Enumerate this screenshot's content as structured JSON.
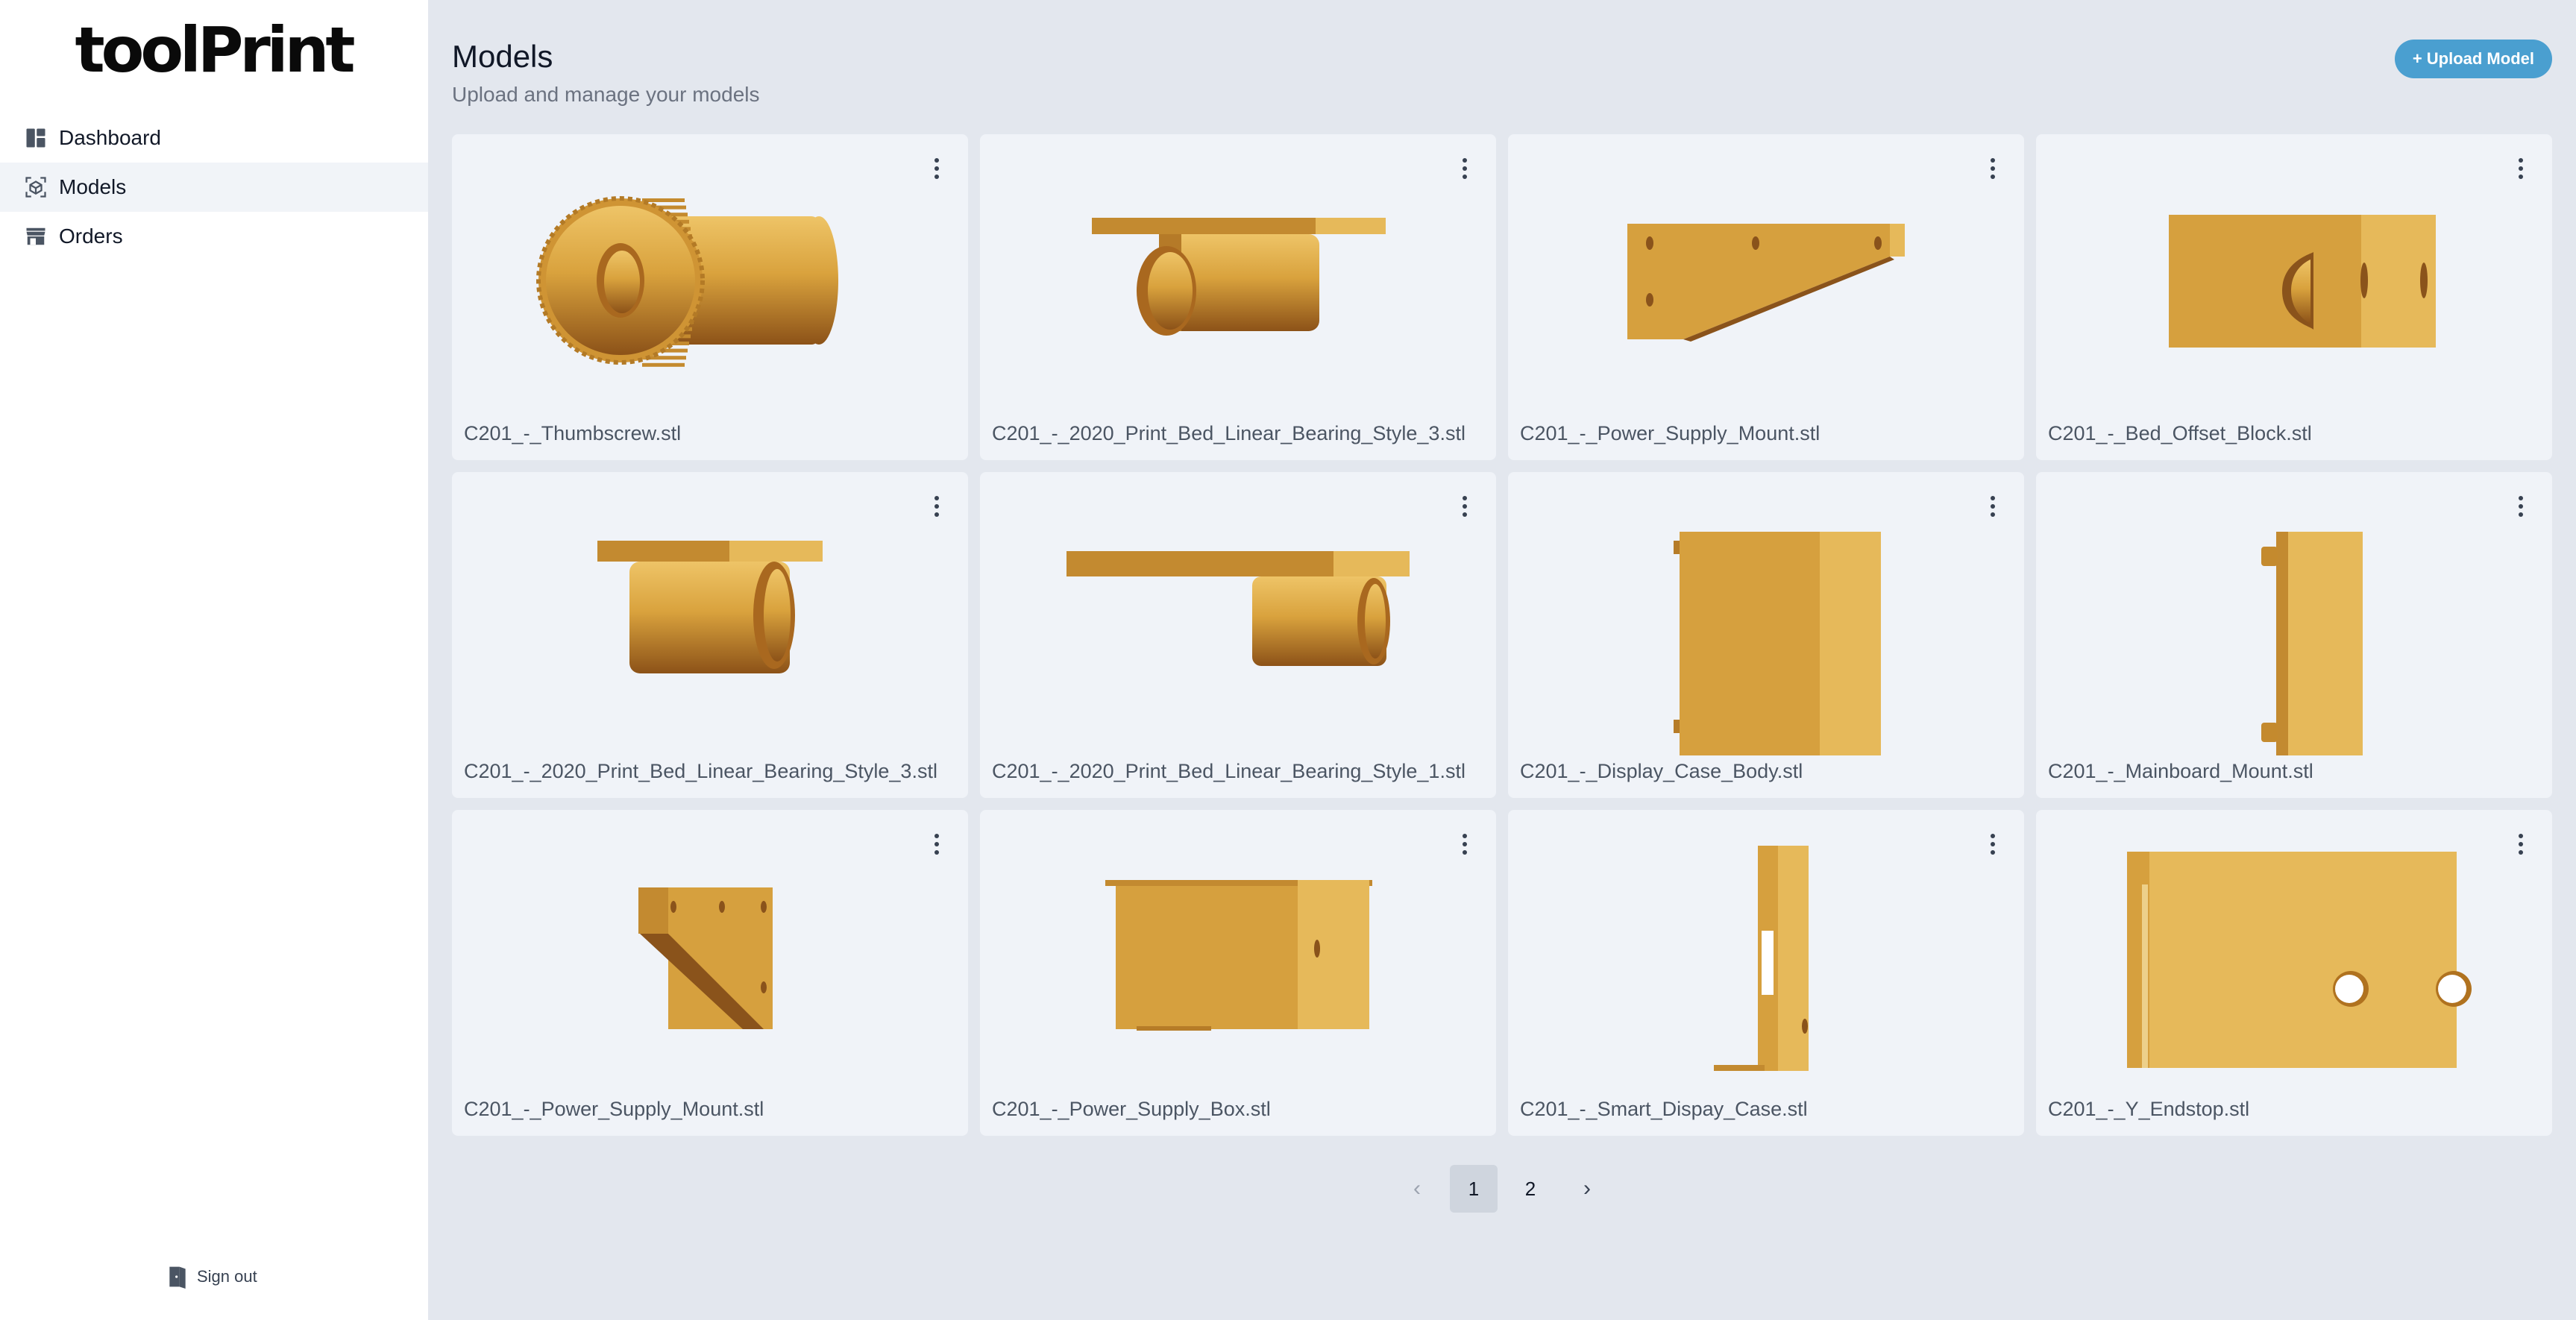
{
  "brand": {
    "logo_text": "toolPrint"
  },
  "sidebar": {
    "items": [
      {
        "label": "Dashboard",
        "icon": "dashboard-icon",
        "active": false
      },
      {
        "label": "Models",
        "icon": "cube-icon",
        "active": true
      },
      {
        "label": "Orders",
        "icon": "store-icon",
        "active": false
      }
    ],
    "signout_label": "Sign out"
  },
  "header": {
    "title": "Models",
    "subtitle": "Upload and manage your models",
    "upload_label": "+ Upload Model"
  },
  "colors": {
    "accent": "#4a9fd0",
    "model": "#d9a23d",
    "background": "#e3e7ee",
    "card": "#f0f3f8"
  },
  "models": [
    {
      "name": "C201_-_Thumbscrew.stl",
      "shape": "thumbscrew"
    },
    {
      "name": "C201_-_2020_Print_Bed_Linear_Bearing_Style_3.stl",
      "shape": "bearing-top"
    },
    {
      "name": "C201_-_Power_Supply_Mount.stl",
      "shape": "psu-mount"
    },
    {
      "name": "C201_-_Bed_Offset_Block.stl",
      "shape": "offset-block"
    },
    {
      "name": "C201_-_2020_Print_Bed_Linear_Bearing_Style_3.stl",
      "shape": "bearing-front"
    },
    {
      "name": "C201_-_2020_Print_Bed_Linear_Bearing_Style_1.stl",
      "shape": "bearing-wide"
    },
    {
      "name": "C201_-_Display_Case_Body.stl",
      "shape": "display-case"
    },
    {
      "name": "C201_-_Mainboard_Mount.stl",
      "shape": "mainboard-mount"
    },
    {
      "name": "C201_-_Power_Supply_Mount.stl",
      "shape": "psu-bracket"
    },
    {
      "name": "C201_-_Power_Supply_Box.stl",
      "shape": "psu-box"
    },
    {
      "name": "C201_-_Smart_Dispay_Case.stl",
      "shape": "smart-case"
    },
    {
      "name": "C201_-_Y_Endstop.stl",
      "shape": "y-endstop"
    }
  ],
  "pagination": {
    "prev": "‹",
    "pages": [
      "1",
      "2"
    ],
    "current": "1",
    "next": "›"
  }
}
